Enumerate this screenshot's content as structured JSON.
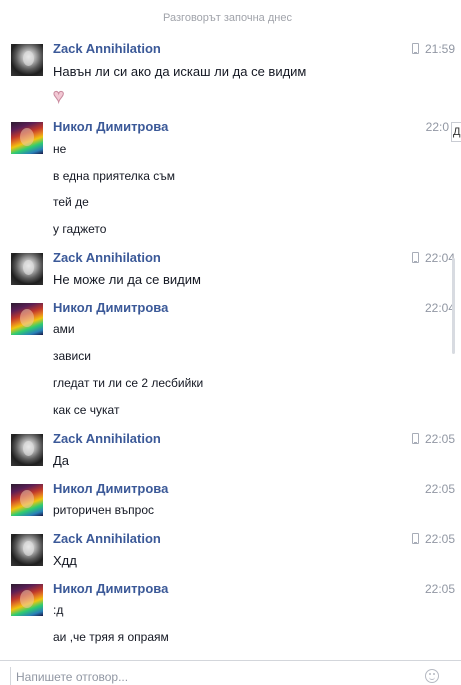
{
  "thread": {
    "start_label": "Разговорът започна днес",
    "tooltip_stub": "Д"
  },
  "messages": [
    {
      "sender": "Zack Annihilation",
      "time": "21:59",
      "mobile": true,
      "lines": [
        "Навън ли си ако да искаш ли да се видим"
      ],
      "sticker": "heart"
    },
    {
      "sender": "Никол Димитрова",
      "time": "22:0",
      "mobile": false,
      "lines": [
        "не",
        "в една приятелка съм",
        "тей де",
        "у гаджето"
      ]
    },
    {
      "sender": "Zack Annihilation",
      "time": "22:04",
      "mobile": true,
      "lines": [
        "Не може ли да се видим"
      ]
    },
    {
      "sender": "Никол Димитрова",
      "time": "22:04",
      "mobile": false,
      "lines": [
        "ами",
        "зависи",
        "гледат ти ли се 2 лесбийки",
        "как се чукат"
      ]
    },
    {
      "sender": "Zack Annihilation",
      "time": "22:05",
      "mobile": true,
      "lines": [
        "Да"
      ]
    },
    {
      "sender": "Никол Димитрова",
      "time": "22:05",
      "mobile": false,
      "lines": [
        "риторичен въпрос"
      ]
    },
    {
      "sender": "Zack Annihilation",
      "time": "22:05",
      "mobile": true,
      "lines": [
        "Хдд"
      ]
    },
    {
      "sender": "Никол Димитрова",
      "time": "22:05",
      "mobile": false,
      "lines": [
        ":д",
        "аи ,че тряя я опраям"
      ]
    }
  ],
  "composer": {
    "placeholder": "Напишете отговор..."
  },
  "colors": {
    "sender_name": "#3b5998",
    "timestamp": "#9197a3",
    "message_text": "#141823"
  }
}
